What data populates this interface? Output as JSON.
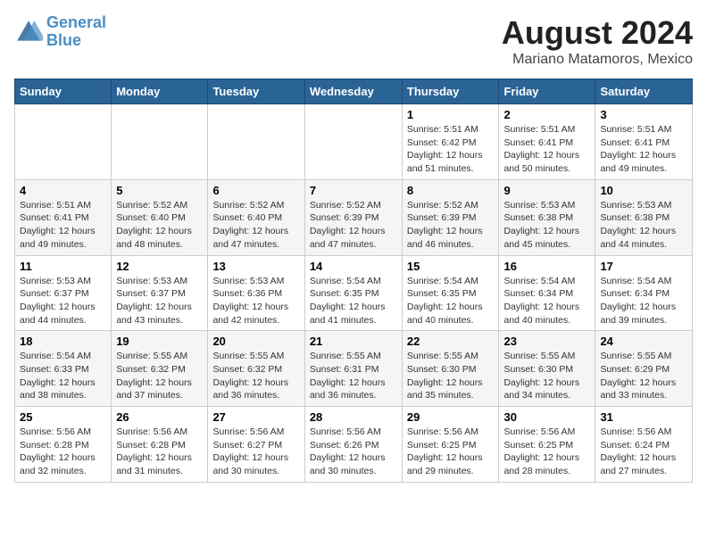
{
  "logo": {
    "line1": "General",
    "line2": "Blue"
  },
  "title": "August 2024",
  "subtitle": "Mariano Matamoros, Mexico",
  "headers": [
    "Sunday",
    "Monday",
    "Tuesday",
    "Wednesday",
    "Thursday",
    "Friday",
    "Saturday"
  ],
  "weeks": [
    [
      {
        "day": "",
        "sunrise": "",
        "sunset": "",
        "daylight": ""
      },
      {
        "day": "",
        "sunrise": "",
        "sunset": "",
        "daylight": ""
      },
      {
        "day": "",
        "sunrise": "",
        "sunset": "",
        "daylight": ""
      },
      {
        "day": "",
        "sunrise": "",
        "sunset": "",
        "daylight": ""
      },
      {
        "day": "1",
        "sunrise": "Sunrise: 5:51 AM",
        "sunset": "Sunset: 6:42 PM",
        "daylight": "Daylight: 12 hours and 51 minutes."
      },
      {
        "day": "2",
        "sunrise": "Sunrise: 5:51 AM",
        "sunset": "Sunset: 6:41 PM",
        "daylight": "Daylight: 12 hours and 50 minutes."
      },
      {
        "day": "3",
        "sunrise": "Sunrise: 5:51 AM",
        "sunset": "Sunset: 6:41 PM",
        "daylight": "Daylight: 12 hours and 49 minutes."
      }
    ],
    [
      {
        "day": "4",
        "sunrise": "Sunrise: 5:51 AM",
        "sunset": "Sunset: 6:41 PM",
        "daylight": "Daylight: 12 hours and 49 minutes."
      },
      {
        "day": "5",
        "sunrise": "Sunrise: 5:52 AM",
        "sunset": "Sunset: 6:40 PM",
        "daylight": "Daylight: 12 hours and 48 minutes."
      },
      {
        "day": "6",
        "sunrise": "Sunrise: 5:52 AM",
        "sunset": "Sunset: 6:40 PM",
        "daylight": "Daylight: 12 hours and 47 minutes."
      },
      {
        "day": "7",
        "sunrise": "Sunrise: 5:52 AM",
        "sunset": "Sunset: 6:39 PM",
        "daylight": "Daylight: 12 hours and 47 minutes."
      },
      {
        "day": "8",
        "sunrise": "Sunrise: 5:52 AM",
        "sunset": "Sunset: 6:39 PM",
        "daylight": "Daylight: 12 hours and 46 minutes."
      },
      {
        "day": "9",
        "sunrise": "Sunrise: 5:53 AM",
        "sunset": "Sunset: 6:38 PM",
        "daylight": "Daylight: 12 hours and 45 minutes."
      },
      {
        "day": "10",
        "sunrise": "Sunrise: 5:53 AM",
        "sunset": "Sunset: 6:38 PM",
        "daylight": "Daylight: 12 hours and 44 minutes."
      }
    ],
    [
      {
        "day": "11",
        "sunrise": "Sunrise: 5:53 AM",
        "sunset": "Sunset: 6:37 PM",
        "daylight": "Daylight: 12 hours and 44 minutes."
      },
      {
        "day": "12",
        "sunrise": "Sunrise: 5:53 AM",
        "sunset": "Sunset: 6:37 PM",
        "daylight": "Daylight: 12 hours and 43 minutes."
      },
      {
        "day": "13",
        "sunrise": "Sunrise: 5:53 AM",
        "sunset": "Sunset: 6:36 PM",
        "daylight": "Daylight: 12 hours and 42 minutes."
      },
      {
        "day": "14",
        "sunrise": "Sunrise: 5:54 AM",
        "sunset": "Sunset: 6:35 PM",
        "daylight": "Daylight: 12 hours and 41 minutes."
      },
      {
        "day": "15",
        "sunrise": "Sunrise: 5:54 AM",
        "sunset": "Sunset: 6:35 PM",
        "daylight": "Daylight: 12 hours and 40 minutes."
      },
      {
        "day": "16",
        "sunrise": "Sunrise: 5:54 AM",
        "sunset": "Sunset: 6:34 PM",
        "daylight": "Daylight: 12 hours and 40 minutes."
      },
      {
        "day": "17",
        "sunrise": "Sunrise: 5:54 AM",
        "sunset": "Sunset: 6:34 PM",
        "daylight": "Daylight: 12 hours and 39 minutes."
      }
    ],
    [
      {
        "day": "18",
        "sunrise": "Sunrise: 5:54 AM",
        "sunset": "Sunset: 6:33 PM",
        "daylight": "Daylight: 12 hours and 38 minutes."
      },
      {
        "day": "19",
        "sunrise": "Sunrise: 5:55 AM",
        "sunset": "Sunset: 6:32 PM",
        "daylight": "Daylight: 12 hours and 37 minutes."
      },
      {
        "day": "20",
        "sunrise": "Sunrise: 5:55 AM",
        "sunset": "Sunset: 6:32 PM",
        "daylight": "Daylight: 12 hours and 36 minutes."
      },
      {
        "day": "21",
        "sunrise": "Sunrise: 5:55 AM",
        "sunset": "Sunset: 6:31 PM",
        "daylight": "Daylight: 12 hours and 36 minutes."
      },
      {
        "day": "22",
        "sunrise": "Sunrise: 5:55 AM",
        "sunset": "Sunset: 6:30 PM",
        "daylight": "Daylight: 12 hours and 35 minutes."
      },
      {
        "day": "23",
        "sunrise": "Sunrise: 5:55 AM",
        "sunset": "Sunset: 6:30 PM",
        "daylight": "Daylight: 12 hours and 34 minutes."
      },
      {
        "day": "24",
        "sunrise": "Sunrise: 5:55 AM",
        "sunset": "Sunset: 6:29 PM",
        "daylight": "Daylight: 12 hours and 33 minutes."
      }
    ],
    [
      {
        "day": "25",
        "sunrise": "Sunrise: 5:56 AM",
        "sunset": "Sunset: 6:28 PM",
        "daylight": "Daylight: 12 hours and 32 minutes."
      },
      {
        "day": "26",
        "sunrise": "Sunrise: 5:56 AM",
        "sunset": "Sunset: 6:28 PM",
        "daylight": "Daylight: 12 hours and 31 minutes."
      },
      {
        "day": "27",
        "sunrise": "Sunrise: 5:56 AM",
        "sunset": "Sunset: 6:27 PM",
        "daylight": "Daylight: 12 hours and 30 minutes."
      },
      {
        "day": "28",
        "sunrise": "Sunrise: 5:56 AM",
        "sunset": "Sunset: 6:26 PM",
        "daylight": "Daylight: 12 hours and 30 minutes."
      },
      {
        "day": "29",
        "sunrise": "Sunrise: 5:56 AM",
        "sunset": "Sunset: 6:25 PM",
        "daylight": "Daylight: 12 hours and 29 minutes."
      },
      {
        "day": "30",
        "sunrise": "Sunrise: 5:56 AM",
        "sunset": "Sunset: 6:25 PM",
        "daylight": "Daylight: 12 hours and 28 minutes."
      },
      {
        "day": "31",
        "sunrise": "Sunrise: 5:56 AM",
        "sunset": "Sunset: 6:24 PM",
        "daylight": "Daylight: 12 hours and 27 minutes."
      }
    ]
  ]
}
